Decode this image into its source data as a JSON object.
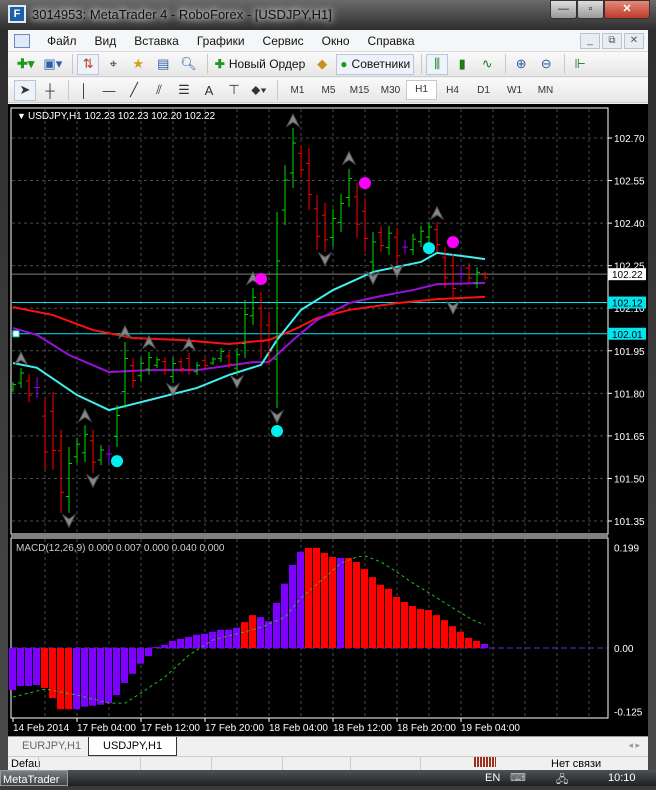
{
  "window": {
    "title": "3014953: MetaTrader 4 - RoboForex - [USDJPY,H1]",
    "minimize": "—",
    "maximize": "▫",
    "close": "✕"
  },
  "menu": {
    "items": [
      "Файл",
      "Вид",
      "Вставка",
      "Графики",
      "Сервис",
      "Окно",
      "Справка"
    ],
    "mdi": [
      "_",
      "⧉",
      "✕"
    ]
  },
  "toolbar": {
    "new_order_label": "Новый Ордер",
    "experts_label": "Советники",
    "timeframes": [
      "M1",
      "M5",
      "M15",
      "M30",
      "H1",
      "H4",
      "D1",
      "W1",
      "MN"
    ],
    "active_timeframe": "H1",
    "text_tool": "A"
  },
  "chart": {
    "header": "USDJPY,H1  102.23 102.23 102.20 102.22",
    "price_ticks": [
      "102.70",
      "102.55",
      "102.40",
      "102.25",
      "102.10",
      "101.95",
      "101.80",
      "101.65",
      "101.50",
      "101.35"
    ],
    "price_tags": [
      {
        "label": "102.22",
        "value": 102.22,
        "bg": "#ffffff",
        "line": "#808080"
      },
      {
        "label": "102.12",
        "value": 102.12,
        "bg": "#00e5ee",
        "line": "#00e5ee"
      },
      {
        "label": "102.01",
        "value": 102.01,
        "bg": "#00e5ee",
        "line": "#00e5ee"
      }
    ],
    "time_labels": [
      "14 Feb 2014",
      "17 Feb 04:00",
      "17 Feb 12:00",
      "17 Feb 20:00",
      "18 Feb 04:00",
      "18 Feb 12:00",
      "18 Feb 20:00",
      "19 Feb 04:00"
    ],
    "colors": {
      "bull": "#00dd00",
      "bear": "#ff0000",
      "doji": "#9900ff",
      "ma_fast": "#40f0f0",
      "ma_mid": "#9b10d8",
      "ma_slow": "#ff1010",
      "grid": "#4a4a4a"
    },
    "bars": [
      [
        101.84,
        101.805,
        "u"
      ],
      [
        101.889,
        101.819,
        "u"
      ],
      [
        101.868,
        101.769,
        "d"
      ],
      [
        101.858,
        101.783,
        "n"
      ],
      [
        101.783,
        101.53,
        "d"
      ],
      [
        101.805,
        101.53,
        "d"
      ],
      [
        101.671,
        101.378,
        "d"
      ],
      [
        101.611,
        101.378,
        "u"
      ],
      [
        101.643,
        101.554,
        "u"
      ],
      [
        101.688,
        101.558,
        "u"
      ],
      [
        101.671,
        101.519,
        "d"
      ],
      [
        101.618,
        101.547,
        "u"
      ],
      [
        101.618,
        101.554,
        "n"
      ],
      [
        101.759,
        101.611,
        "u"
      ],
      [
        101.981,
        101.748,
        "u"
      ],
      [
        101.924,
        101.819,
        "d"
      ],
      [
        101.928,
        101.84,
        "u"
      ],
      [
        101.946,
        101.865,
        "u"
      ],
      [
        101.928,
        101.889,
        "u"
      ],
      [
        101.928,
        101.865,
        "d"
      ],
      [
        101.928,
        101.836,
        "u"
      ],
      [
        101.924,
        101.875,
        "d"
      ],
      [
        101.942,
        101.865,
        "d"
      ],
      [
        101.91,
        101.865,
        "u"
      ],
      [
        101.924,
        101.889,
        "d"
      ],
      [
        101.928,
        101.9,
        "u"
      ],
      [
        101.96,
        101.91,
        "u"
      ],
      [
        101.946,
        101.889,
        "d"
      ],
      [
        101.96,
        101.865,
        "u"
      ],
      [
        102.129,
        101.924,
        "u"
      ],
      [
        102.171,
        102.041,
        "u"
      ],
      [
        102.157,
        101.924,
        "d"
      ],
      [
        102.087,
        101.9,
        "d"
      ],
      [
        102.439,
        101.748,
        "u"
      ],
      [
        102.605,
        102.393,
        "u"
      ],
      [
        102.735,
        102.524,
        "u"
      ],
      [
        102.675,
        102.559,
        "d"
      ],
      [
        102.665,
        102.446,
        "d"
      ],
      [
        102.499,
        102.305,
        "d"
      ],
      [
        102.471,
        102.298,
        "d"
      ],
      [
        102.45,
        102.316,
        "u"
      ],
      [
        102.503,
        102.369,
        "u"
      ],
      [
        102.591,
        102.457,
        "u"
      ],
      [
        102.541,
        102.348,
        "d"
      ],
      [
        102.489,
        102.298,
        "d"
      ],
      [
        102.369,
        102.228,
        "u"
      ],
      [
        102.39,
        102.298,
        "d"
      ],
      [
        102.39,
        102.288,
        "u"
      ],
      [
        102.383,
        102.252,
        "d"
      ],
      [
        102.34,
        102.291,
        "n"
      ],
      [
        102.362,
        102.288,
        "u"
      ],
      [
        102.39,
        102.316,
        "u"
      ],
      [
        102.404,
        102.333,
        "u"
      ],
      [
        102.404,
        102.298,
        "d"
      ],
      [
        102.316,
        102.171,
        "d"
      ],
      [
        102.291,
        102.129,
        "d"
      ],
      [
        102.252,
        102.192,
        "n"
      ],
      [
        102.259,
        102.189,
        "d"
      ],
      [
        102.245,
        102.171,
        "u"
      ],
      [
        102.23,
        102.2,
        "d"
      ]
    ],
    "ma_fast": [
      [
        0,
        101.907
      ],
      [
        3,
        101.89
      ],
      [
        8,
        101.794
      ],
      [
        12,
        101.741
      ],
      [
        17,
        101.776
      ],
      [
        23,
        101.819
      ],
      [
        27,
        101.865
      ],
      [
        31,
        101.9
      ],
      [
        33,
        101.988
      ],
      [
        36,
        102.094
      ],
      [
        40,
        102.164
      ],
      [
        45,
        102.228
      ],
      [
        51,
        102.263
      ],
      [
        53,
        102.295
      ],
      [
        57,
        102.281
      ],
      [
        59,
        102.273
      ]
    ],
    "ma_mid": [
      [
        0,
        102.03
      ],
      [
        3,
        102.006
      ],
      [
        7,
        101.935
      ],
      [
        12,
        101.875
      ],
      [
        17,
        101.882
      ],
      [
        23,
        101.882
      ],
      [
        30,
        101.91
      ],
      [
        32,
        101.91
      ],
      [
        35,
        101.988
      ],
      [
        38,
        102.058
      ],
      [
        42,
        102.118
      ],
      [
        46,
        102.143
      ],
      [
        50,
        102.164
      ],
      [
        53,
        102.185
      ],
      [
        59,
        102.189
      ]
    ],
    "ma_slow": [
      [
        0,
        102.104
      ],
      [
        5,
        102.076
      ],
      [
        10,
        102.023
      ],
      [
        15,
        101.995
      ],
      [
        21,
        101.988
      ],
      [
        27,
        101.974
      ],
      [
        32,
        101.988
      ],
      [
        35,
        102.023
      ],
      [
        38,
        102.065
      ],
      [
        42,
        102.094
      ],
      [
        48,
        102.118
      ],
      [
        53,
        102.132
      ],
      [
        59,
        102.14
      ]
    ],
    "fractals_up": [
      [
        1,
        101.924
      ],
      [
        9,
        101.723
      ],
      [
        14,
        102.016
      ],
      [
        17,
        101.981
      ],
      [
        22,
        101.974
      ],
      [
        30,
        102.206
      ],
      [
        35,
        102.763
      ],
      [
        42,
        102.63
      ],
      [
        53,
        102.436
      ]
    ],
    "fractals_down": [
      [
        7,
        101.35
      ],
      [
        10,
        101.491
      ],
      [
        20,
        101.812
      ],
      [
        28,
        101.84
      ],
      [
        33,
        101.717
      ],
      [
        39,
        102.273
      ],
      [
        45,
        102.206
      ],
      [
        48,
        102.231
      ],
      [
        55,
        102.101
      ]
    ],
    "signals_buy": [
      [
        13,
        101.561
      ],
      [
        33,
        101.667
      ],
      [
        52,
        102.312
      ]
    ],
    "signals_sell": [
      [
        31,
        102.203
      ],
      [
        44,
        102.541
      ],
      [
        55,
        102.333
      ]
    ]
  },
  "chart_data": {
    "type": "bar",
    "title": "MACD(12,26,9) 0.000 0.007 0.000 0.040 0.000",
    "ylim": [
      -0.125,
      0.199
    ],
    "y_ticks": [
      "0.199",
      "0.00",
      "-0.125"
    ],
    "histogram": [
      -0.083,
      -0.075,
      -0.075,
      -0.073,
      -0.079,
      -0.099,
      -0.121,
      -0.121,
      -0.121,
      -0.116,
      -0.114,
      -0.112,
      -0.109,
      -0.093,
      -0.069,
      -0.051,
      -0.031,
      -0.016,
      0.002,
      0.006,
      0.014,
      0.018,
      0.022,
      0.026,
      0.028,
      0.032,
      0.036,
      0.036,
      0.04,
      0.051,
      0.065,
      0.061,
      0.053,
      0.089,
      0.127,
      0.164,
      0.19,
      0.198,
      0.198,
      0.188,
      0.18,
      0.178,
      0.178,
      0.17,
      0.156,
      0.14,
      0.125,
      0.117,
      0.101,
      0.091,
      0.083,
      0.077,
      0.075,
      0.065,
      0.055,
      0.043,
      0.032,
      0.02,
      0.014,
      0.008
    ],
    "histogram_colors": "pppprrrrppppppppppppppppppppprrpppppprrrrprrrrrrrrrrrrrrrrr",
    "signal": [
      [
        0,
        -0.097
      ],
      [
        4,
        -0.081
      ],
      [
        8,
        -0.093
      ],
      [
        12,
        -0.109
      ],
      [
        14,
        -0.109
      ],
      [
        16,
        -0.089
      ],
      [
        19,
        -0.057
      ],
      [
        22,
        -0.014
      ],
      [
        25,
        0.016
      ],
      [
        29,
        0.032
      ],
      [
        31,
        0.041
      ],
      [
        34,
        0.061
      ],
      [
        36,
        0.099
      ],
      [
        39,
        0.14
      ],
      [
        41,
        0.168
      ],
      [
        43,
        0.18
      ],
      [
        44,
        0.182
      ],
      [
        46,
        0.17
      ],
      [
        48,
        0.15
      ],
      [
        50,
        0.128
      ],
      [
        52,
        0.109
      ],
      [
        54,
        0.089
      ],
      [
        56,
        0.069
      ],
      [
        58,
        0.051
      ],
      [
        59,
        0.047
      ]
    ]
  },
  "tabs": [
    {
      "label": "EURJPY,H1",
      "active": false
    },
    {
      "label": "USDJPY,H1",
      "active": true
    }
  ],
  "tab_arrows": "◂ ▸",
  "status": {
    "profile": "Defau",
    "connection": "Нет связи"
  },
  "taskbar": {
    "app": "MetaTrader",
    "lang": "EN",
    "time": "10:10"
  }
}
